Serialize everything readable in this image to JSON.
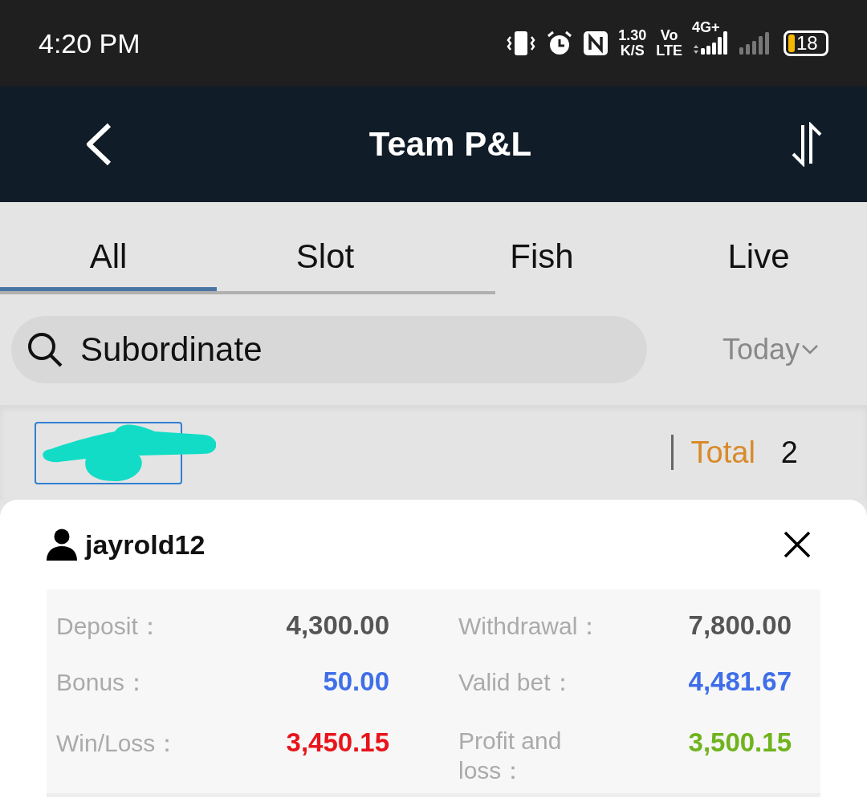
{
  "status_bar": {
    "time": "4:20 PM",
    "speed": "1.30",
    "speed_unit": "K/S",
    "volte_top": "Vo",
    "volte_bottom": "LTE",
    "network": "4G+",
    "battery": "18"
  },
  "header": {
    "title": "Team P&L"
  },
  "tabs": [
    {
      "label": "All",
      "selected": true
    },
    {
      "label": "Slot",
      "selected": false
    },
    {
      "label": "Fish",
      "selected": false
    },
    {
      "label": "Live",
      "selected": false
    }
  ],
  "search": {
    "placeholder": "Subordinate"
  },
  "date_filter": {
    "value": "Today"
  },
  "summary": {
    "total_label": "Total",
    "total_value": "2"
  },
  "member": {
    "username": "jayrold12",
    "stats": [
      {
        "label": "Deposit：",
        "value": "4,300.00",
        "color": "#555555"
      },
      {
        "label": "Withdrawal：",
        "value": "7,800.00",
        "color": "#555555"
      },
      {
        "label": "Bonus：",
        "value": "50.00",
        "color": "#3f6ee8"
      },
      {
        "label": "Valid bet：",
        "value": "4,481.67",
        "color": "#3f6ee8"
      },
      {
        "label": "Win/Loss：",
        "value": "3,450.15",
        "color": "#e8141b"
      },
      {
        "label": "Profit and loss：",
        "value": "3,500.15",
        "color": "#6fb41c"
      }
    ]
  }
}
